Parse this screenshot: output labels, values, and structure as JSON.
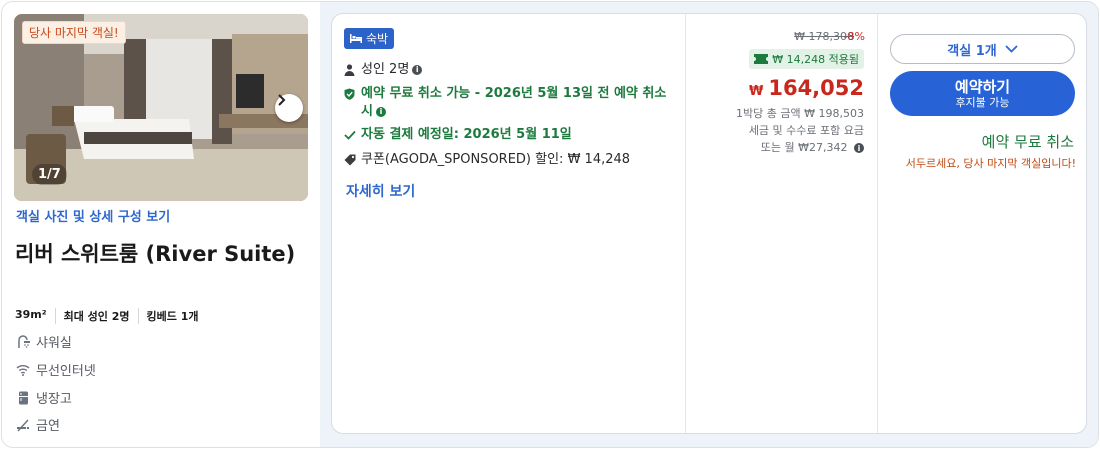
{
  "photo": {
    "badge": "당사 마지막 객실!",
    "counter": "1/7",
    "link": "객실 사진 및 상세 구성 보기"
  },
  "room": {
    "name": "리버 스위트룸 (River Suite)",
    "facts": [
      "39m²",
      "최대 성인 2명",
      "킹베드 1개"
    ],
    "amenities": [
      {
        "icon": "shower-icon",
        "label": "샤워실"
      },
      {
        "icon": "wifi-icon",
        "label": "무선인터넷"
      },
      {
        "icon": "fridge-icon",
        "label": "냉장고"
      },
      {
        "icon": "no-smoking-icon",
        "label": "금연"
      }
    ]
  },
  "offer": {
    "tag": "숙박",
    "guests": "성인 2명",
    "free_cancel_line": "예약 무료 취소 가능 - 2026년 5월 13일 전 예약 취소 시",
    "auto_pay": "자동 결제 예정일: 2026년 5월 11일",
    "coupon": "쿠폰(AGODA_SPONSORED) 할인: ₩ 14,248",
    "details_link": "자세히 보기"
  },
  "price": {
    "original": "₩ 178,300",
    "discount": "-8%",
    "applied": "₩ 14,248 적용됨",
    "currency": "₩",
    "amount": "164,052",
    "total_line": "1박당 총 금액 ₩ 198,503",
    "tax_line": "세금 및 수수료 포함 요금",
    "monthly_line": "또는 월 ₩27,342"
  },
  "booking": {
    "rooms": "객실 1개",
    "button_main": "예약하기",
    "button_sub": "후지불 가능",
    "free_cancel": "예약 무료 취소",
    "hurry": "서두르세요, 당사 마지막 객실입니다!"
  },
  "colors": {
    "accent": "#2763d6",
    "price_red": "#c8271c",
    "green": "#1d7a3e",
    "warning_orange": "#c24a12"
  }
}
